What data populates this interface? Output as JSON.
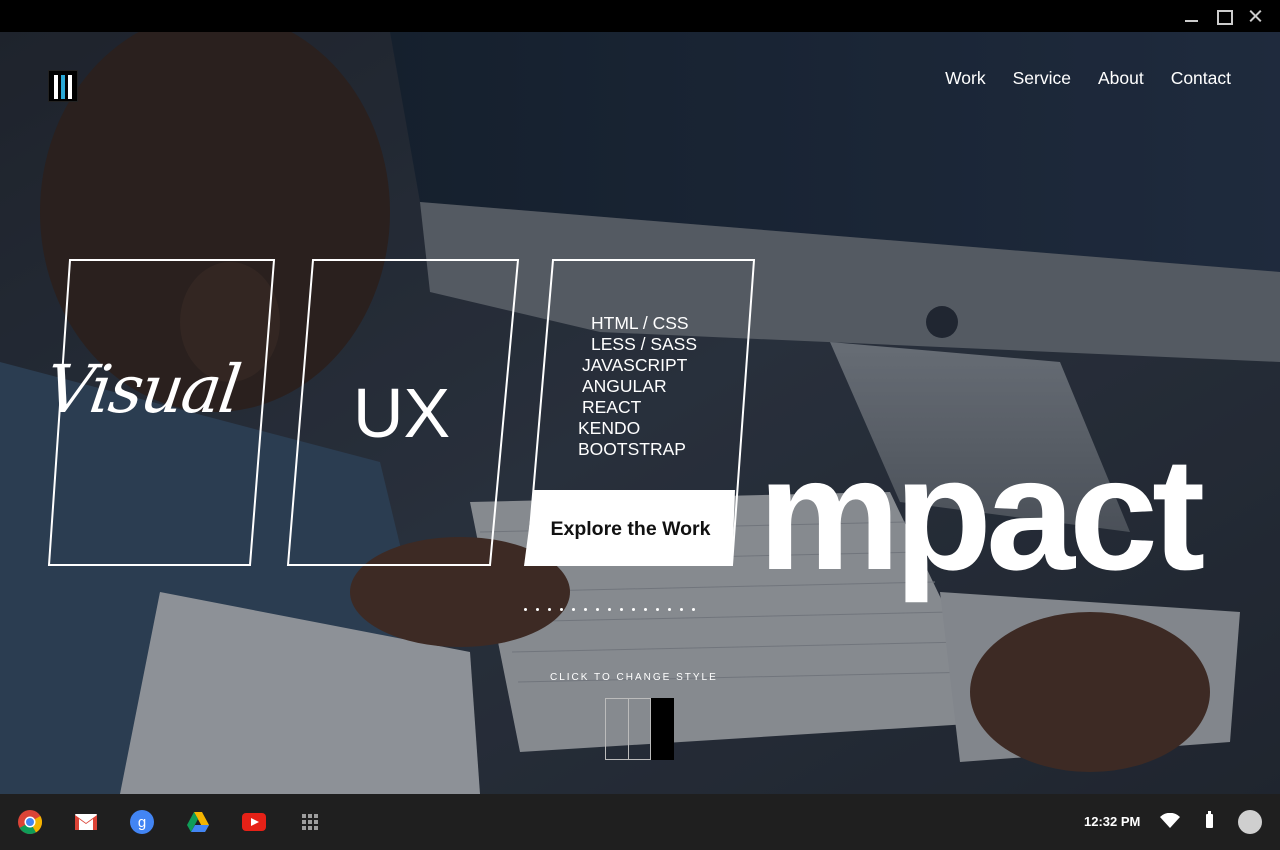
{
  "window": {
    "minimize_icon": "minimize-icon",
    "maximize_icon": "maximize-icon",
    "close_icon": "close-icon"
  },
  "site": {
    "logo_icon": "three-bars-logo-icon",
    "nav": [
      {
        "label": "Work"
      },
      {
        "label": "Service"
      },
      {
        "label": "About"
      },
      {
        "label": "Contact"
      }
    ],
    "panels": {
      "visual_label": "Visual",
      "ux_label": "UX",
      "skills": [
        "HTML / CSS",
        "LESS / SASS",
        "JAVASCRIPT",
        "ANGULAR",
        "REACT",
        "KENDO",
        "BOOTSTRAP"
      ],
      "explore_label": "Explore the Work"
    },
    "big_word": "mpact",
    "dots_count": 15,
    "change_style_label": "CLICK TO CHANGE STYLE",
    "style_swatches": [
      "outline",
      "outline",
      "black"
    ]
  },
  "taskbar": {
    "apps": [
      {
        "name": "chrome-icon"
      },
      {
        "name": "gmail-icon"
      },
      {
        "name": "google-search-icon"
      },
      {
        "name": "google-drive-icon"
      },
      {
        "name": "youtube-icon"
      },
      {
        "name": "app-launcher-icon"
      }
    ],
    "time": "12:32 PM",
    "wifi_icon": "wifi-icon",
    "battery_icon": "battery-icon",
    "avatar_icon": "avatar-icon"
  },
  "colors": {
    "accent": "#29a8d6",
    "taskbar_bg": "#1f1f1f",
    "title_bar_bg": "#000000"
  }
}
